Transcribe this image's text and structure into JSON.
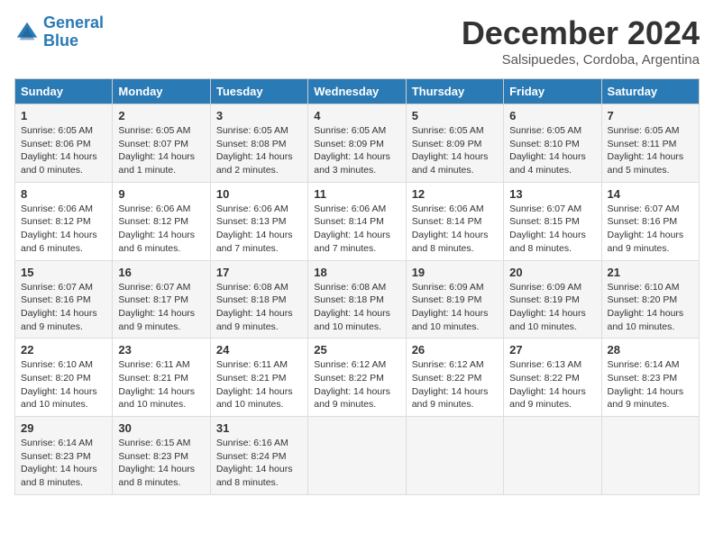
{
  "logo": {
    "line1": "General",
    "line2": "Blue"
  },
  "title": "December 2024",
  "subtitle": "Salsipuedes, Cordoba, Argentina",
  "days_of_week": [
    "Sunday",
    "Monday",
    "Tuesday",
    "Wednesday",
    "Thursday",
    "Friday",
    "Saturday"
  ],
  "weeks": [
    [
      {
        "day": "1",
        "info": "Sunrise: 6:05 AM\nSunset: 8:06 PM\nDaylight: 14 hours\nand 0 minutes."
      },
      {
        "day": "2",
        "info": "Sunrise: 6:05 AM\nSunset: 8:07 PM\nDaylight: 14 hours\nand 1 minute."
      },
      {
        "day": "3",
        "info": "Sunrise: 6:05 AM\nSunset: 8:08 PM\nDaylight: 14 hours\nand 2 minutes."
      },
      {
        "day": "4",
        "info": "Sunrise: 6:05 AM\nSunset: 8:09 PM\nDaylight: 14 hours\nand 3 minutes."
      },
      {
        "day": "5",
        "info": "Sunrise: 6:05 AM\nSunset: 8:09 PM\nDaylight: 14 hours\nand 4 minutes."
      },
      {
        "day": "6",
        "info": "Sunrise: 6:05 AM\nSunset: 8:10 PM\nDaylight: 14 hours\nand 4 minutes."
      },
      {
        "day": "7",
        "info": "Sunrise: 6:05 AM\nSunset: 8:11 PM\nDaylight: 14 hours\nand 5 minutes."
      }
    ],
    [
      {
        "day": "8",
        "info": "Sunrise: 6:06 AM\nSunset: 8:12 PM\nDaylight: 14 hours\nand 6 minutes."
      },
      {
        "day": "9",
        "info": "Sunrise: 6:06 AM\nSunset: 8:12 PM\nDaylight: 14 hours\nand 6 minutes."
      },
      {
        "day": "10",
        "info": "Sunrise: 6:06 AM\nSunset: 8:13 PM\nDaylight: 14 hours\nand 7 minutes."
      },
      {
        "day": "11",
        "info": "Sunrise: 6:06 AM\nSunset: 8:14 PM\nDaylight: 14 hours\nand 7 minutes."
      },
      {
        "day": "12",
        "info": "Sunrise: 6:06 AM\nSunset: 8:14 PM\nDaylight: 14 hours\nand 8 minutes."
      },
      {
        "day": "13",
        "info": "Sunrise: 6:07 AM\nSunset: 8:15 PM\nDaylight: 14 hours\nand 8 minutes."
      },
      {
        "day": "14",
        "info": "Sunrise: 6:07 AM\nSunset: 8:16 PM\nDaylight: 14 hours\nand 9 minutes."
      }
    ],
    [
      {
        "day": "15",
        "info": "Sunrise: 6:07 AM\nSunset: 8:16 PM\nDaylight: 14 hours\nand 9 minutes."
      },
      {
        "day": "16",
        "info": "Sunrise: 6:07 AM\nSunset: 8:17 PM\nDaylight: 14 hours\nand 9 minutes."
      },
      {
        "day": "17",
        "info": "Sunrise: 6:08 AM\nSunset: 8:18 PM\nDaylight: 14 hours\nand 9 minutes."
      },
      {
        "day": "18",
        "info": "Sunrise: 6:08 AM\nSunset: 8:18 PM\nDaylight: 14 hours\nand 10 minutes."
      },
      {
        "day": "19",
        "info": "Sunrise: 6:09 AM\nSunset: 8:19 PM\nDaylight: 14 hours\nand 10 minutes."
      },
      {
        "day": "20",
        "info": "Sunrise: 6:09 AM\nSunset: 8:19 PM\nDaylight: 14 hours\nand 10 minutes."
      },
      {
        "day": "21",
        "info": "Sunrise: 6:10 AM\nSunset: 8:20 PM\nDaylight: 14 hours\nand 10 minutes."
      }
    ],
    [
      {
        "day": "22",
        "info": "Sunrise: 6:10 AM\nSunset: 8:20 PM\nDaylight: 14 hours\nand 10 minutes."
      },
      {
        "day": "23",
        "info": "Sunrise: 6:11 AM\nSunset: 8:21 PM\nDaylight: 14 hours\nand 10 minutes."
      },
      {
        "day": "24",
        "info": "Sunrise: 6:11 AM\nSunset: 8:21 PM\nDaylight: 14 hours\nand 10 minutes."
      },
      {
        "day": "25",
        "info": "Sunrise: 6:12 AM\nSunset: 8:22 PM\nDaylight: 14 hours\nand 9 minutes."
      },
      {
        "day": "26",
        "info": "Sunrise: 6:12 AM\nSunset: 8:22 PM\nDaylight: 14 hours\nand 9 minutes."
      },
      {
        "day": "27",
        "info": "Sunrise: 6:13 AM\nSunset: 8:22 PM\nDaylight: 14 hours\nand 9 minutes."
      },
      {
        "day": "28",
        "info": "Sunrise: 6:14 AM\nSunset: 8:23 PM\nDaylight: 14 hours\nand 9 minutes."
      }
    ],
    [
      {
        "day": "29",
        "info": "Sunrise: 6:14 AM\nSunset: 8:23 PM\nDaylight: 14 hours\nand 8 minutes."
      },
      {
        "day": "30",
        "info": "Sunrise: 6:15 AM\nSunset: 8:23 PM\nDaylight: 14 hours\nand 8 minutes."
      },
      {
        "day": "31",
        "info": "Sunrise: 6:16 AM\nSunset: 8:24 PM\nDaylight: 14 hours\nand 8 minutes."
      },
      {
        "day": "",
        "info": ""
      },
      {
        "day": "",
        "info": ""
      },
      {
        "day": "",
        "info": ""
      },
      {
        "day": "",
        "info": ""
      }
    ]
  ]
}
